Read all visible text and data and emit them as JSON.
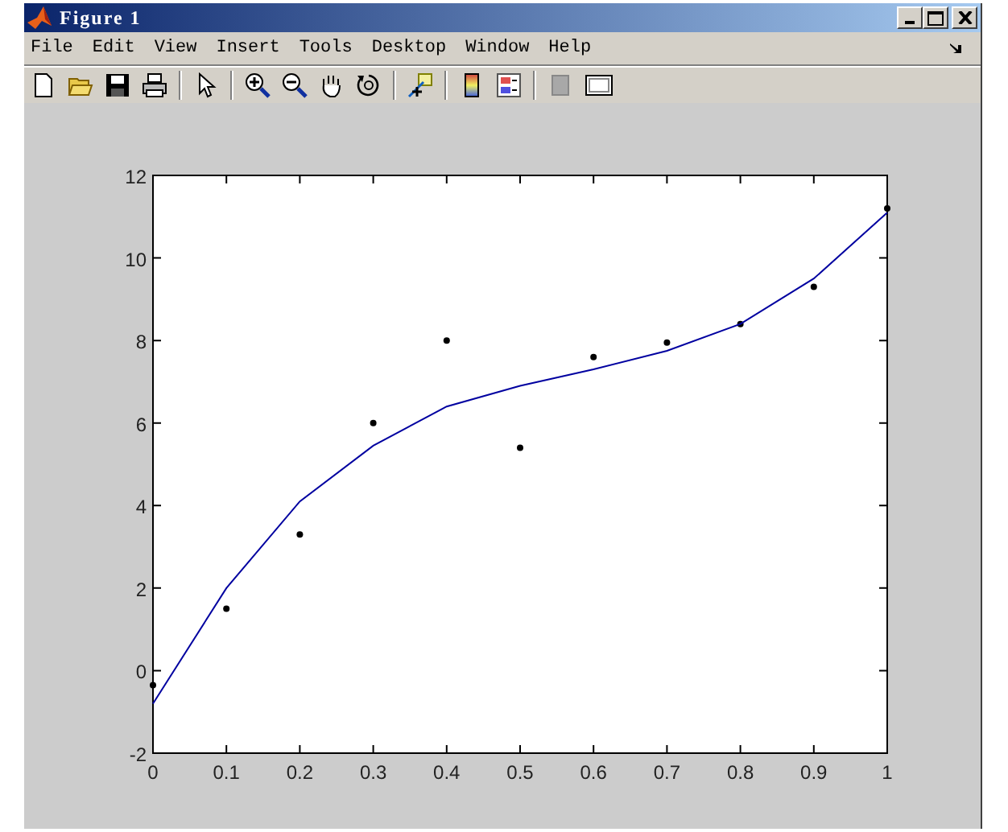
{
  "window": {
    "title": "Figure 1"
  },
  "menu": [
    "File",
    "Edit",
    "View",
    "Insert",
    "Tools",
    "Desktop",
    "Window",
    "Help"
  ],
  "toolbar": [
    {
      "kind": "new"
    },
    {
      "kind": "open"
    },
    {
      "kind": "save"
    },
    {
      "kind": "print"
    },
    {
      "kind": "sep"
    },
    {
      "kind": "pointer"
    },
    {
      "kind": "sep"
    },
    {
      "kind": "zoomin"
    },
    {
      "kind": "zoomout"
    },
    {
      "kind": "pan"
    },
    {
      "kind": "rotate"
    },
    {
      "kind": "sep"
    },
    {
      "kind": "datacursor"
    },
    {
      "kind": "sep"
    },
    {
      "kind": "colorbar"
    },
    {
      "kind": "legend"
    },
    {
      "kind": "sep"
    },
    {
      "kind": "hidetools"
    },
    {
      "kind": "showtools"
    }
  ],
  "plot": {
    "chart_data": {
      "type": "scatter",
      "x": [
        0,
        0.1,
        0.2,
        0.3,
        0.4,
        0.5,
        0.6,
        0.7,
        0.8,
        0.9,
        1
      ],
      "xlim": [
        0,
        1
      ],
      "ylim": [
        -2,
        12
      ],
      "xticks": [
        0,
        0.1,
        0.2,
        0.3,
        0.4,
        0.5,
        0.6,
        0.7,
        0.8,
        0.9,
        1
      ],
      "yticks": [
        -2,
        0,
        2,
        4,
        6,
        8,
        10,
        12
      ],
      "series": [
        {
          "marker": "circle",
          "color": "#000000",
          "values": [
            -0.35,
            1.5,
            3.3,
            6.0,
            8.0,
            5.4,
            7.6,
            7.95,
            8.4,
            9.3,
            11.2
          ]
        },
        {
          "type": "line",
          "color": "#0000a0",
          "values": [
            -0.8,
            2.0,
            4.1,
            5.45,
            6.4,
            6.9,
            7.3,
            7.75,
            8.4,
            9.5,
            11.1
          ]
        }
      ]
    }
  }
}
